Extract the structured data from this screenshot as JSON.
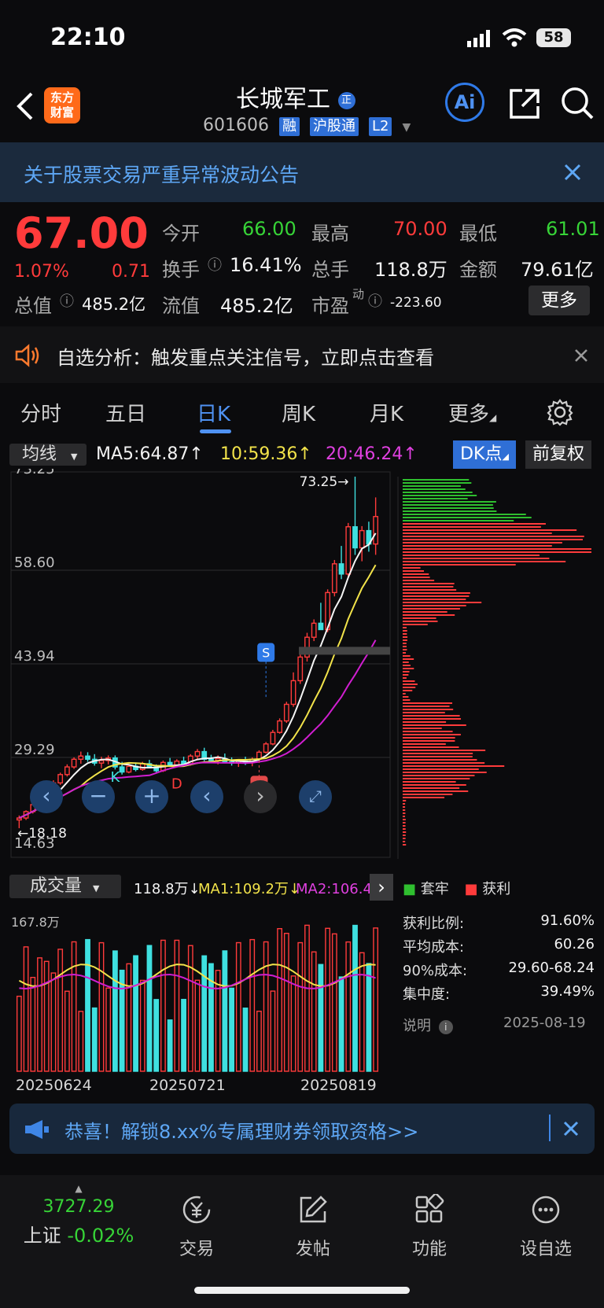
{
  "status": {
    "time": "22:10",
    "battery": "58"
  },
  "header": {
    "logo_top": "东方",
    "logo_bottom": "财富",
    "title": "长城军工",
    "title_badge": "正",
    "code": "601606",
    "tag_margin": "融",
    "tag_connect": "沪股通",
    "tag_level": "L2",
    "ai": "Ai"
  },
  "notice": {
    "text": "关于股票交易严重异常波动公告"
  },
  "quote": {
    "price": "67.00",
    "pct": "1.07%",
    "chg": "0.71",
    "open_label": "今开",
    "open": "66.00",
    "high_label": "最高",
    "high": "70.00",
    "low_label": "最低",
    "low": "61.01",
    "turnover_label": "换手",
    "turnover": "16.41%",
    "volume_label": "总手",
    "volume": "118.8万",
    "amount_label": "金额",
    "amount": "79.61亿",
    "mcap_label": "总值",
    "mcap": "485.2亿",
    "float_label": "流值",
    "float": "485.2亿",
    "pe_label": "市盈",
    "pe_sup": "动",
    "pe": "-223.60",
    "more": "更多"
  },
  "alert": {
    "text": "自选分析：触发重点关注信号，立即点击查看"
  },
  "tabs": [
    "分时",
    "五日",
    "日K",
    "周K",
    "月K",
    "更多"
  ],
  "active_tab": 2,
  "ma_bar": {
    "selector": "均线",
    "ma5": "MA5:64.87↑",
    "ma10": "10:59.36↑",
    "ma20": "20:46.24↑",
    "dk": "DK点",
    "adjust": "前复权"
  },
  "colors": {
    "up": "#ff3b3b",
    "down": "#3fe0e0",
    "ma5": "#f5f5f5",
    "ma10": "#f2e34a",
    "ma20": "#d01ed0",
    "profit": "#ff3b3b",
    "trapped": "#2fbf2f"
  },
  "chart_data": [
    {
      "type": "candlestick",
      "y_ticks": [
        "73.25",
        "58.60",
        "43.94",
        "29.29",
        "14.63"
      ],
      "ylim": [
        14.63,
        73.25
      ],
      "annotations": {
        "high_label": "73.25→",
        "low_label": "←18.18",
        "markers": [
          "K",
          "D",
          "S",
          "B"
        ]
      },
      "candles": [
        [
          19.5,
          20.2,
          18.2,
          19.8
        ],
        [
          19.8,
          21.0,
          19.5,
          20.8
        ],
        [
          20.8,
          22.2,
          20.5,
          21.9
        ],
        [
          21.9,
          23.3,
          21.5,
          23.0
        ],
        [
          23.0,
          24.6,
          22.8,
          24.2
        ],
        [
          24.2,
          25.7,
          24.0,
          25.3
        ],
        [
          25.3,
          26.9,
          25.0,
          26.6
        ],
        [
          26.6,
          28.2,
          26.3,
          27.8
        ],
        [
          27.8,
          29.3,
          27.5,
          29.0
        ],
        [
          29.0,
          30.2,
          28.3,
          29.5
        ],
        [
          29.5,
          30.1,
          28.6,
          29.0
        ],
        [
          29.0,
          29.8,
          28.0,
          28.4
        ],
        [
          28.4,
          29.4,
          27.6,
          28.8
        ],
        [
          28.8,
          29.6,
          28.2,
          29.2
        ],
        [
          29.2,
          29.6,
          27.4,
          27.8
        ],
        [
          27.8,
          28.6,
          26.6,
          27.0
        ],
        [
          27.0,
          28.1,
          26.8,
          27.9
        ],
        [
          27.9,
          28.5,
          27.1,
          27.4
        ],
        [
          27.4,
          28.6,
          27.2,
          28.3
        ],
        [
          28.3,
          28.9,
          27.6,
          27.8
        ],
        [
          27.8,
          28.2,
          26.9,
          27.2
        ],
        [
          27.2,
          28.8,
          27.0,
          28.5
        ],
        [
          28.5,
          29.2,
          27.9,
          28.1
        ],
        [
          28.1,
          29.0,
          27.7,
          28.7
        ],
        [
          28.7,
          29.4,
          28.0,
          28.3
        ],
        [
          28.3,
          29.8,
          28.0,
          29.5
        ],
        [
          29.5,
          30.6,
          29.0,
          30.2
        ],
        [
          30.2,
          30.8,
          28.7,
          29.0
        ],
        [
          29.0,
          29.7,
          28.4,
          28.8
        ],
        [
          28.8,
          29.6,
          28.2,
          29.1
        ],
        [
          29.1,
          29.9,
          28.4,
          28.6
        ],
        [
          28.6,
          29.3,
          28.0,
          28.4
        ],
        [
          28.4,
          29.0,
          27.8,
          28.7
        ],
        [
          28.7,
          29.4,
          28.1,
          28.5
        ],
        [
          28.5,
          29.3,
          27.9,
          29.0
        ],
        [
          29.0,
          30.4,
          28.8,
          30.1
        ],
        [
          30.1,
          31.7,
          29.9,
          31.4
        ],
        [
          31.4,
          33.6,
          31.2,
          33.2
        ],
        [
          33.2,
          35.4,
          33.0,
          35.0
        ],
        [
          35.0,
          38.0,
          34.7,
          37.6
        ],
        [
          37.6,
          42.6,
          37.2,
          41.3
        ],
        [
          41.3,
          45.6,
          40.8,
          45.0
        ],
        [
          45.0,
          48.8,
          44.3,
          48.1
        ],
        [
          48.1,
          50.9,
          47.5,
          50.3
        ],
        [
          50.3,
          53.5,
          49.8,
          49.3
        ],
        [
          49.3,
          55.6,
          48.9,
          55.1
        ],
        [
          55.1,
          60.2,
          54.5,
          59.6
        ],
        [
          59.6,
          62.4,
          57.2,
          58.0
        ],
        [
          58.0,
          66.0,
          57.5,
          65.4
        ],
        [
          65.4,
          73.25,
          61.0,
          62.1
        ],
        [
          62.1,
          65.5,
          60.0,
          64.8
        ],
        [
          64.8,
          66.2,
          61.5,
          62.7
        ],
        [
          62.7,
          70.0,
          61.01,
          67.0
        ]
      ]
    },
    {
      "type": "volume_bar",
      "y_max_label": "167.8万",
      "x_labels": [
        "20250624",
        "20250721",
        "20250819"
      ],
      "legend": {
        "selector": "成交量",
        "vol": "118.8万↓",
        "ma1": "MA1:109.2万↓",
        "ma2": "MA2:106.4万↑"
      }
    },
    {
      "type": "chip_distribution",
      "legend": {
        "trapped": "套牢",
        "profit": "获利"
      },
      "stats": [
        {
          "label": "获利比例:",
          "value": "91.60%"
        },
        {
          "label": "平均成本:",
          "value": "60.26"
        },
        {
          "label": "90%成本:",
          "value": "29.60-68.24"
        },
        {
          "label": "集中度:",
          "value": "39.49%"
        }
      ],
      "note_label": "说明",
      "date": "2025-08-19"
    }
  ],
  "promo": {
    "text": "恭喜！解锁8.xx%专属理财券领取资格>>"
  },
  "bottom": {
    "index_value": "3727.29",
    "index_name": "上证",
    "index_change": "-0.02%",
    "items": [
      "交易",
      "发帖",
      "功能",
      "设自选"
    ]
  }
}
